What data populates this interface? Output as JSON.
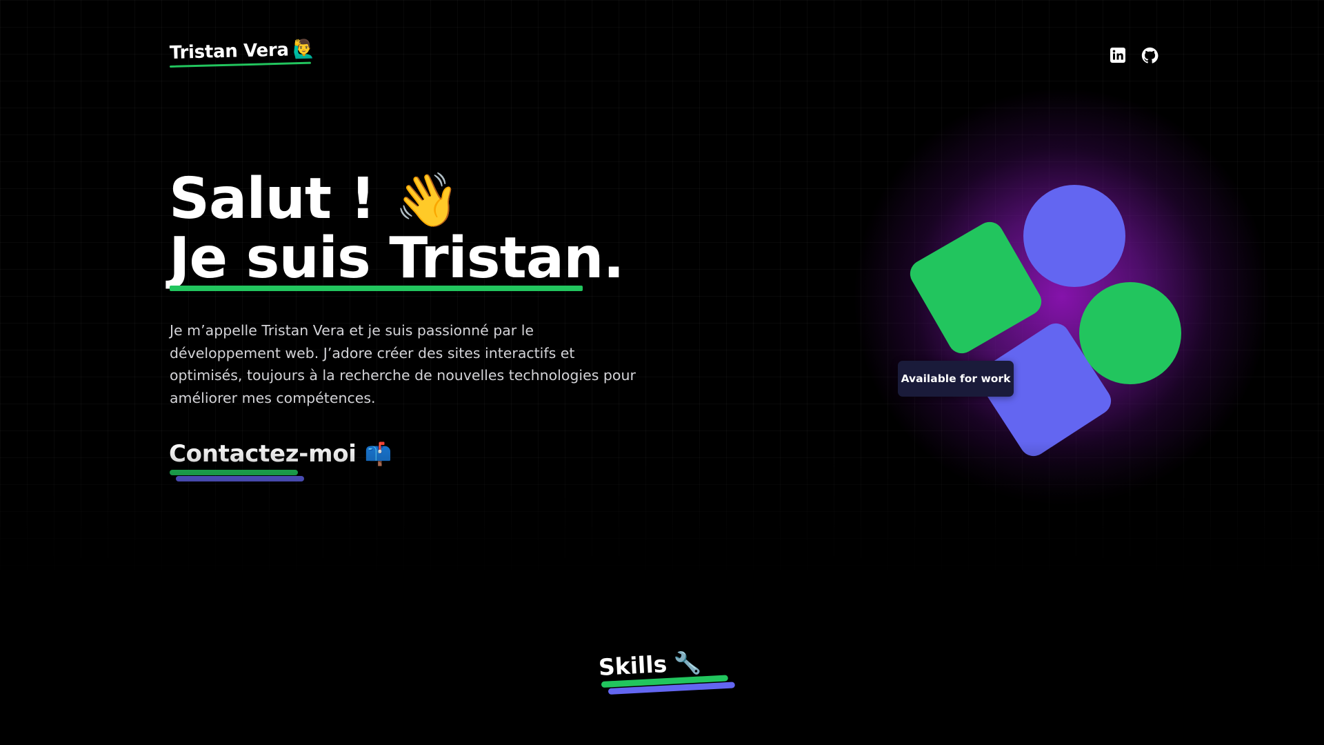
{
  "header": {
    "brand_name": "Tristan Vera",
    "brand_emoji": "🙋‍♂️",
    "social": [
      {
        "icon": "linkedin-icon",
        "label": "LinkedIn"
      },
      {
        "icon": "github-icon",
        "label": "GitHub"
      }
    ]
  },
  "hero": {
    "greeting": "Salut !",
    "greeting_emoji": "👋",
    "headline": "Je suis Tristan.",
    "intro": "Je m’appelle Tristan Vera et je suis passionné par le développement web. J’adore créer des sites interactifs et optimisés, toujours à la recherche de nouvelles technologies pour améliorer mes compétences.",
    "cta_label": "Contactez-moi",
    "cta_emoji": "📫"
  },
  "illustration": {
    "badge_text": "Available for work",
    "colors": {
      "green": "#22c55e",
      "indigo": "#6366f1",
      "glow": "#8c14b4",
      "badge_bg": "#1a1b3a"
    }
  },
  "skills": {
    "title": "Skills",
    "emoji": "🔧"
  },
  "theme": {
    "background": "#000000",
    "text": "#ffffff",
    "muted_text": "#d4d4d8",
    "accent_green": "#22c55e",
    "accent_indigo": "#6366f1"
  }
}
